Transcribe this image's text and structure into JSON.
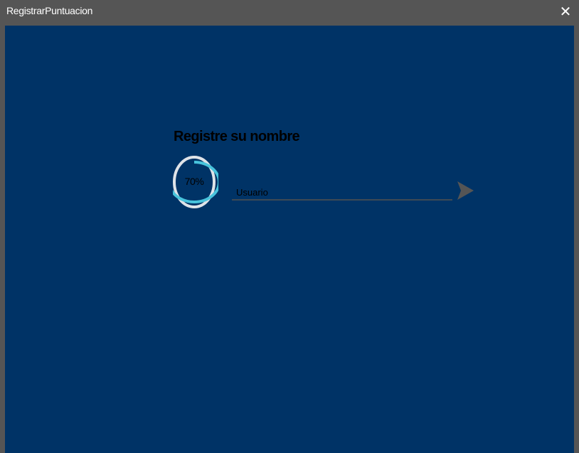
{
  "window": {
    "title": "RegistrarPuntuacion",
    "close_glyph": "✕"
  },
  "form": {
    "heading": "Registre su nombre",
    "progress": {
      "value": 0.7,
      "label": "70%",
      "fill_color": "#48c3dc",
      "track_color": "#dfe3e8"
    },
    "username": {
      "placeholder": "Usuario",
      "value": ""
    },
    "send_icon": "send-icon"
  },
  "colors": {
    "background": "#003366",
    "titlebar": "#555555",
    "send_button": "#555555"
  }
}
